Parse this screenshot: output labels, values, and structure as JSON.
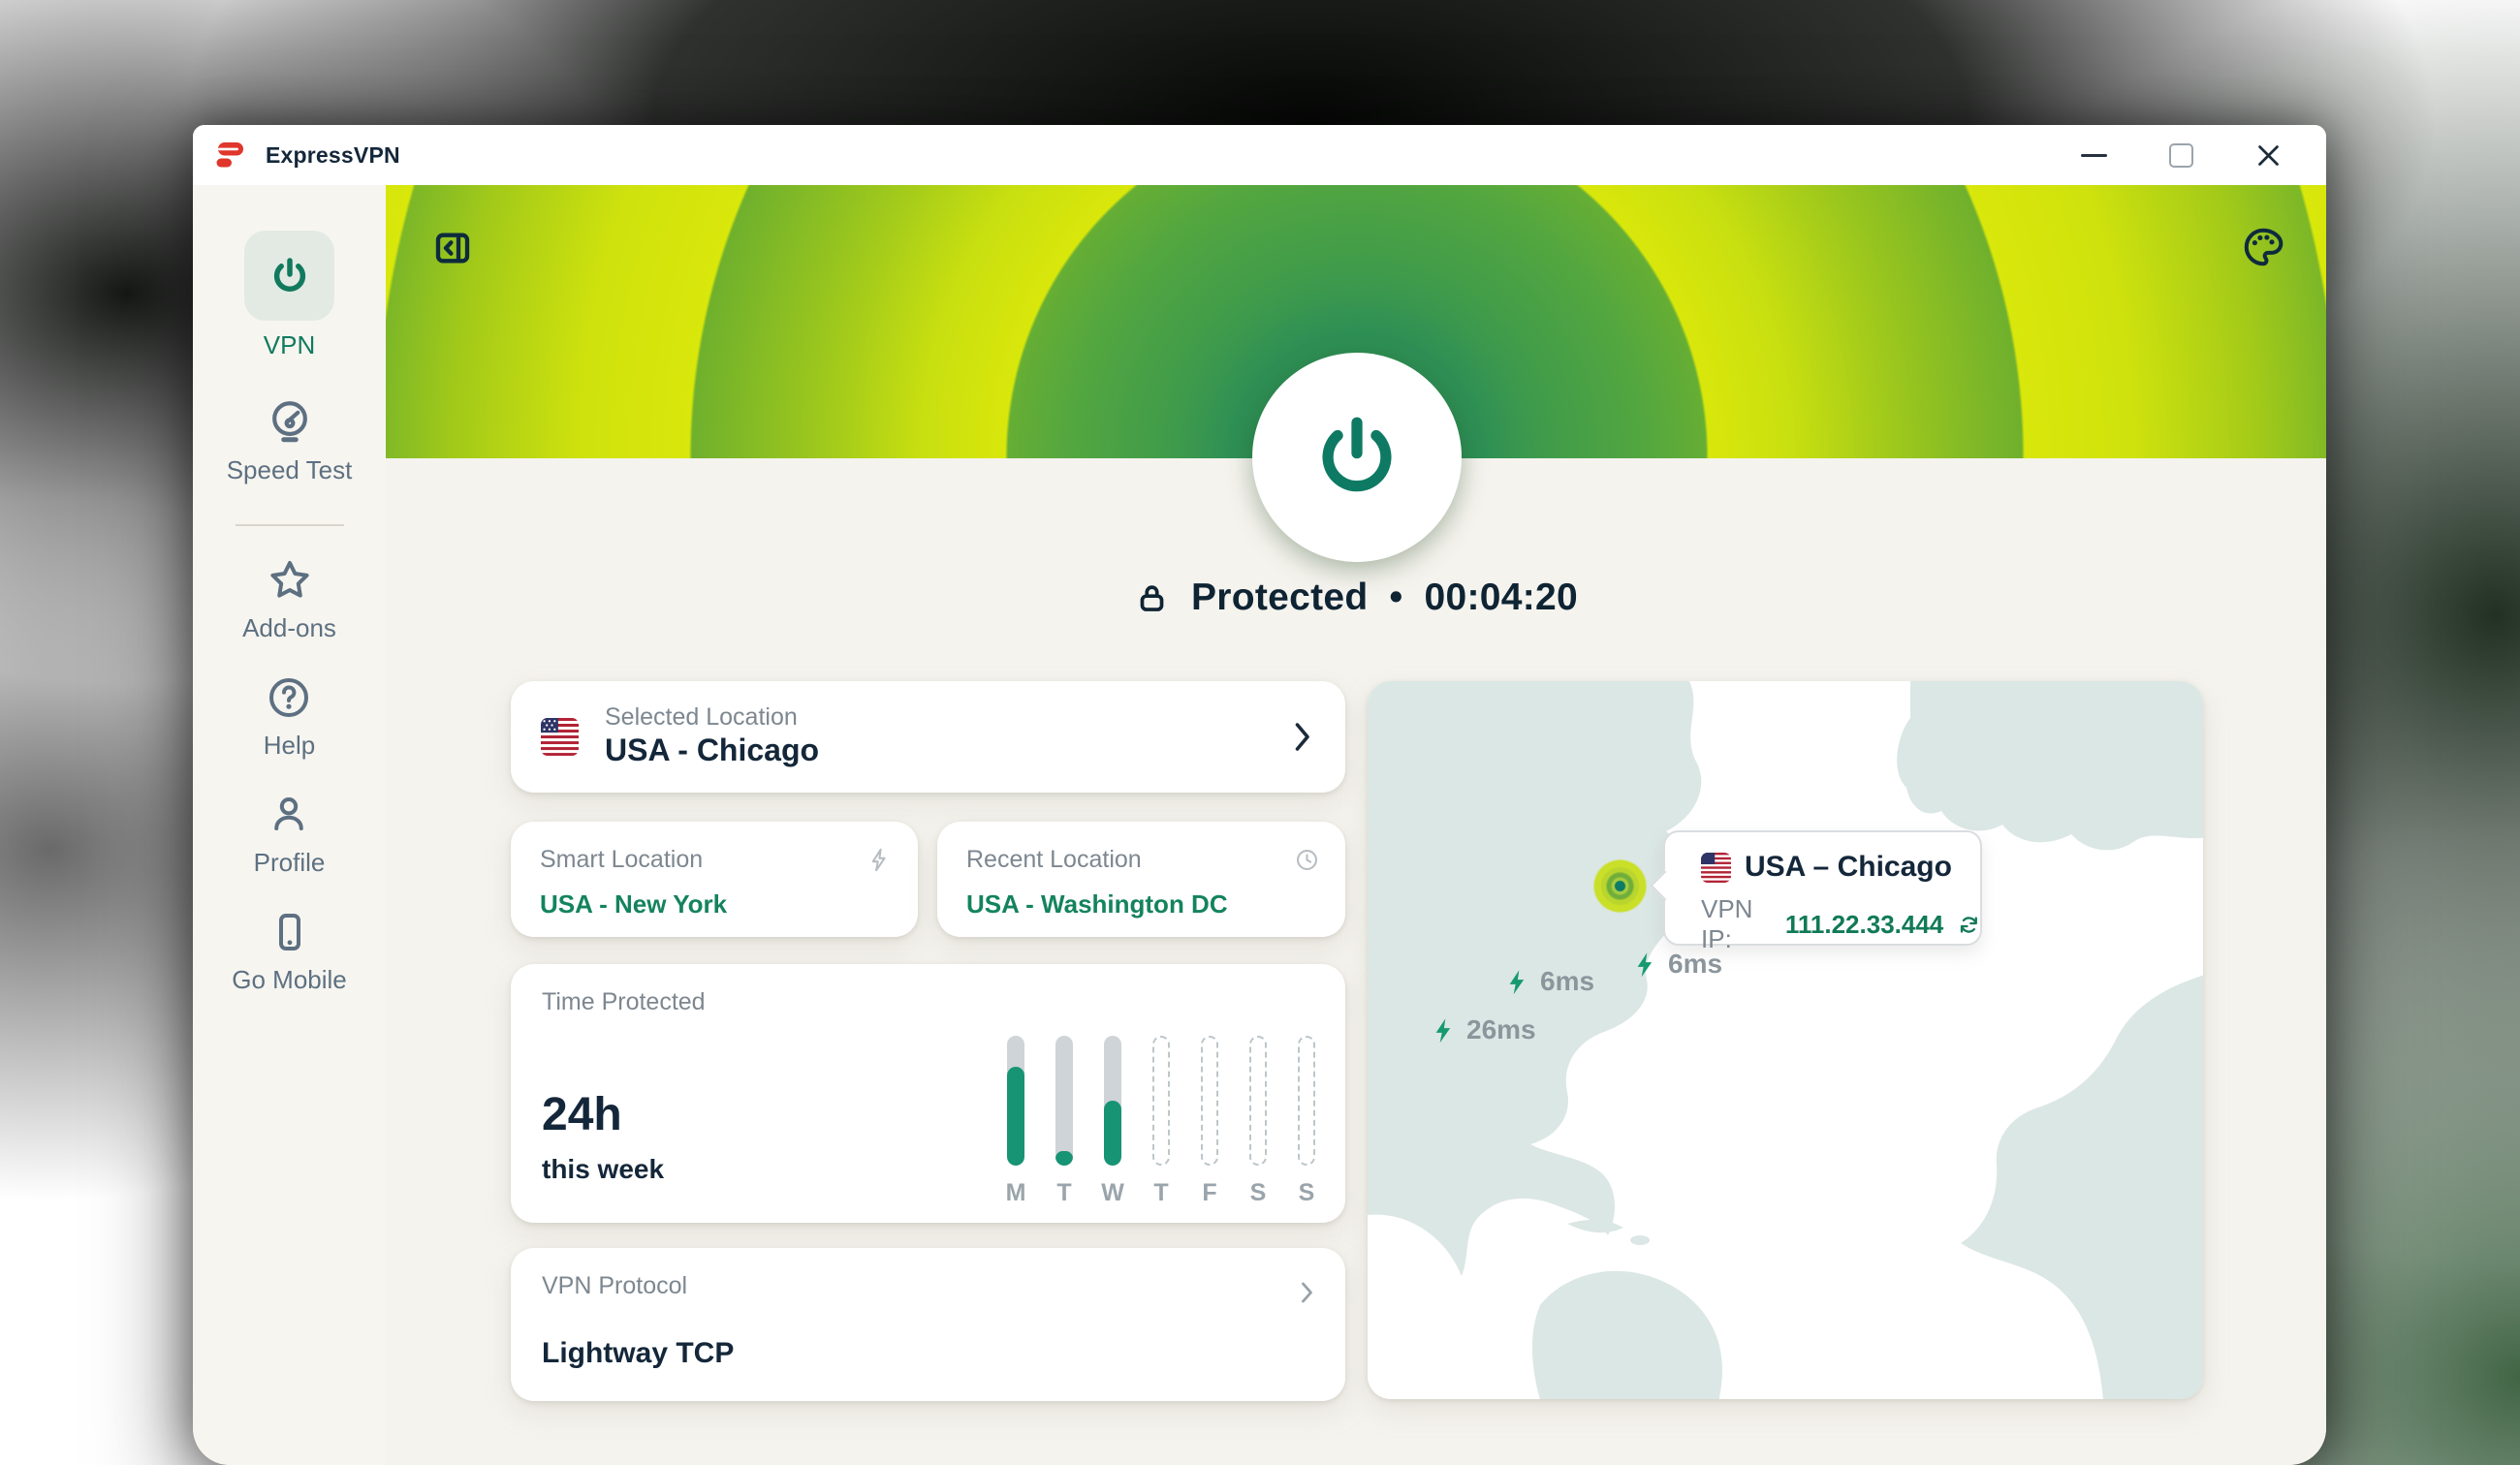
{
  "titlebar": {
    "title": "ExpressVPN"
  },
  "window_controls": {
    "minimize_icon": "minimize",
    "maximize_icon": "maximize",
    "close_icon": "close"
  },
  "sidebar": {
    "items": [
      {
        "label": "VPN",
        "icon": "power-icon",
        "active": true
      },
      {
        "label": "Speed Test",
        "icon": "speedometer-icon",
        "active": false
      },
      {
        "label": "Add-ons",
        "icon": "star-icon",
        "active": false
      },
      {
        "label": "Help",
        "icon": "help-circle-icon",
        "active": false
      },
      {
        "label": "Profile",
        "icon": "user-icon",
        "active": false
      },
      {
        "label": "Go Mobile",
        "icon": "smartphone-icon",
        "active": false
      }
    ]
  },
  "header": {
    "collapse_icon": "sidebar-collapse-icon",
    "theme_icon": "palette-icon",
    "power_button_state": "on"
  },
  "status": {
    "lock_icon": "lock-icon",
    "label": "Protected",
    "separator": "•",
    "timer": "00:04:20"
  },
  "cards": {
    "selected_location": {
      "label": "Selected Location",
      "value": "USA - Chicago",
      "flag": "us-flag"
    },
    "smart_location": {
      "label": "Smart Location",
      "value": "USA - New York",
      "icon": "lightning-bolt-icon"
    },
    "recent_location": {
      "label": "Recent Location",
      "value": "USA - Washington DC",
      "icon": "clock-icon"
    },
    "time_protected": {
      "label": "Time Protected",
      "total": "24h",
      "period": "this week"
    },
    "vpn_protocol": {
      "label": "VPN Protocol",
      "value": "Lightway TCP"
    }
  },
  "chart_data": {
    "type": "bar",
    "title": "Time Protected",
    "categories": [
      "M",
      "T",
      "W",
      "T",
      "F",
      "S",
      "S"
    ],
    "series": [
      {
        "name": "fill_percent_of_day",
        "values": [
          76,
          11,
          50,
          null,
          null,
          null,
          null
        ]
      }
    ],
    "ylim": [
      0,
      100
    ],
    "legend": false,
    "note": "null values render as dashed empty bars (future days)"
  },
  "map": {
    "tooltip": {
      "flag": "us-flag",
      "location": "USA – Chicago",
      "ip_label": "VPN IP:",
      "ip": "111.22.33.444",
      "refresh_icon": "refresh-icon"
    },
    "latency_markers": [
      {
        "icon": "lightning-bolt-icon",
        "value": "6ms"
      },
      {
        "icon": "lightning-bolt-icon",
        "value": "6ms"
      },
      {
        "icon": "lightning-bolt-icon",
        "value": "26ms"
      }
    ]
  },
  "colors": {
    "brand_red": "#e0362c",
    "accent_green": "#14835e",
    "power_teal": "#0e7a63",
    "header_yellow": "#d9e70b",
    "header_green": "#62ac35",
    "header_center_green": "#2e8f55",
    "text_dark": "#14273a",
    "text_gray": "#7d8790",
    "muted_icon": "#b6bdc2",
    "bar_track": "#ced4d7",
    "bar_fill": "#169474",
    "day_label": "#9aa4ab",
    "map_land": "#dbe7e4",
    "sidebar_text": "#5d7081"
  }
}
